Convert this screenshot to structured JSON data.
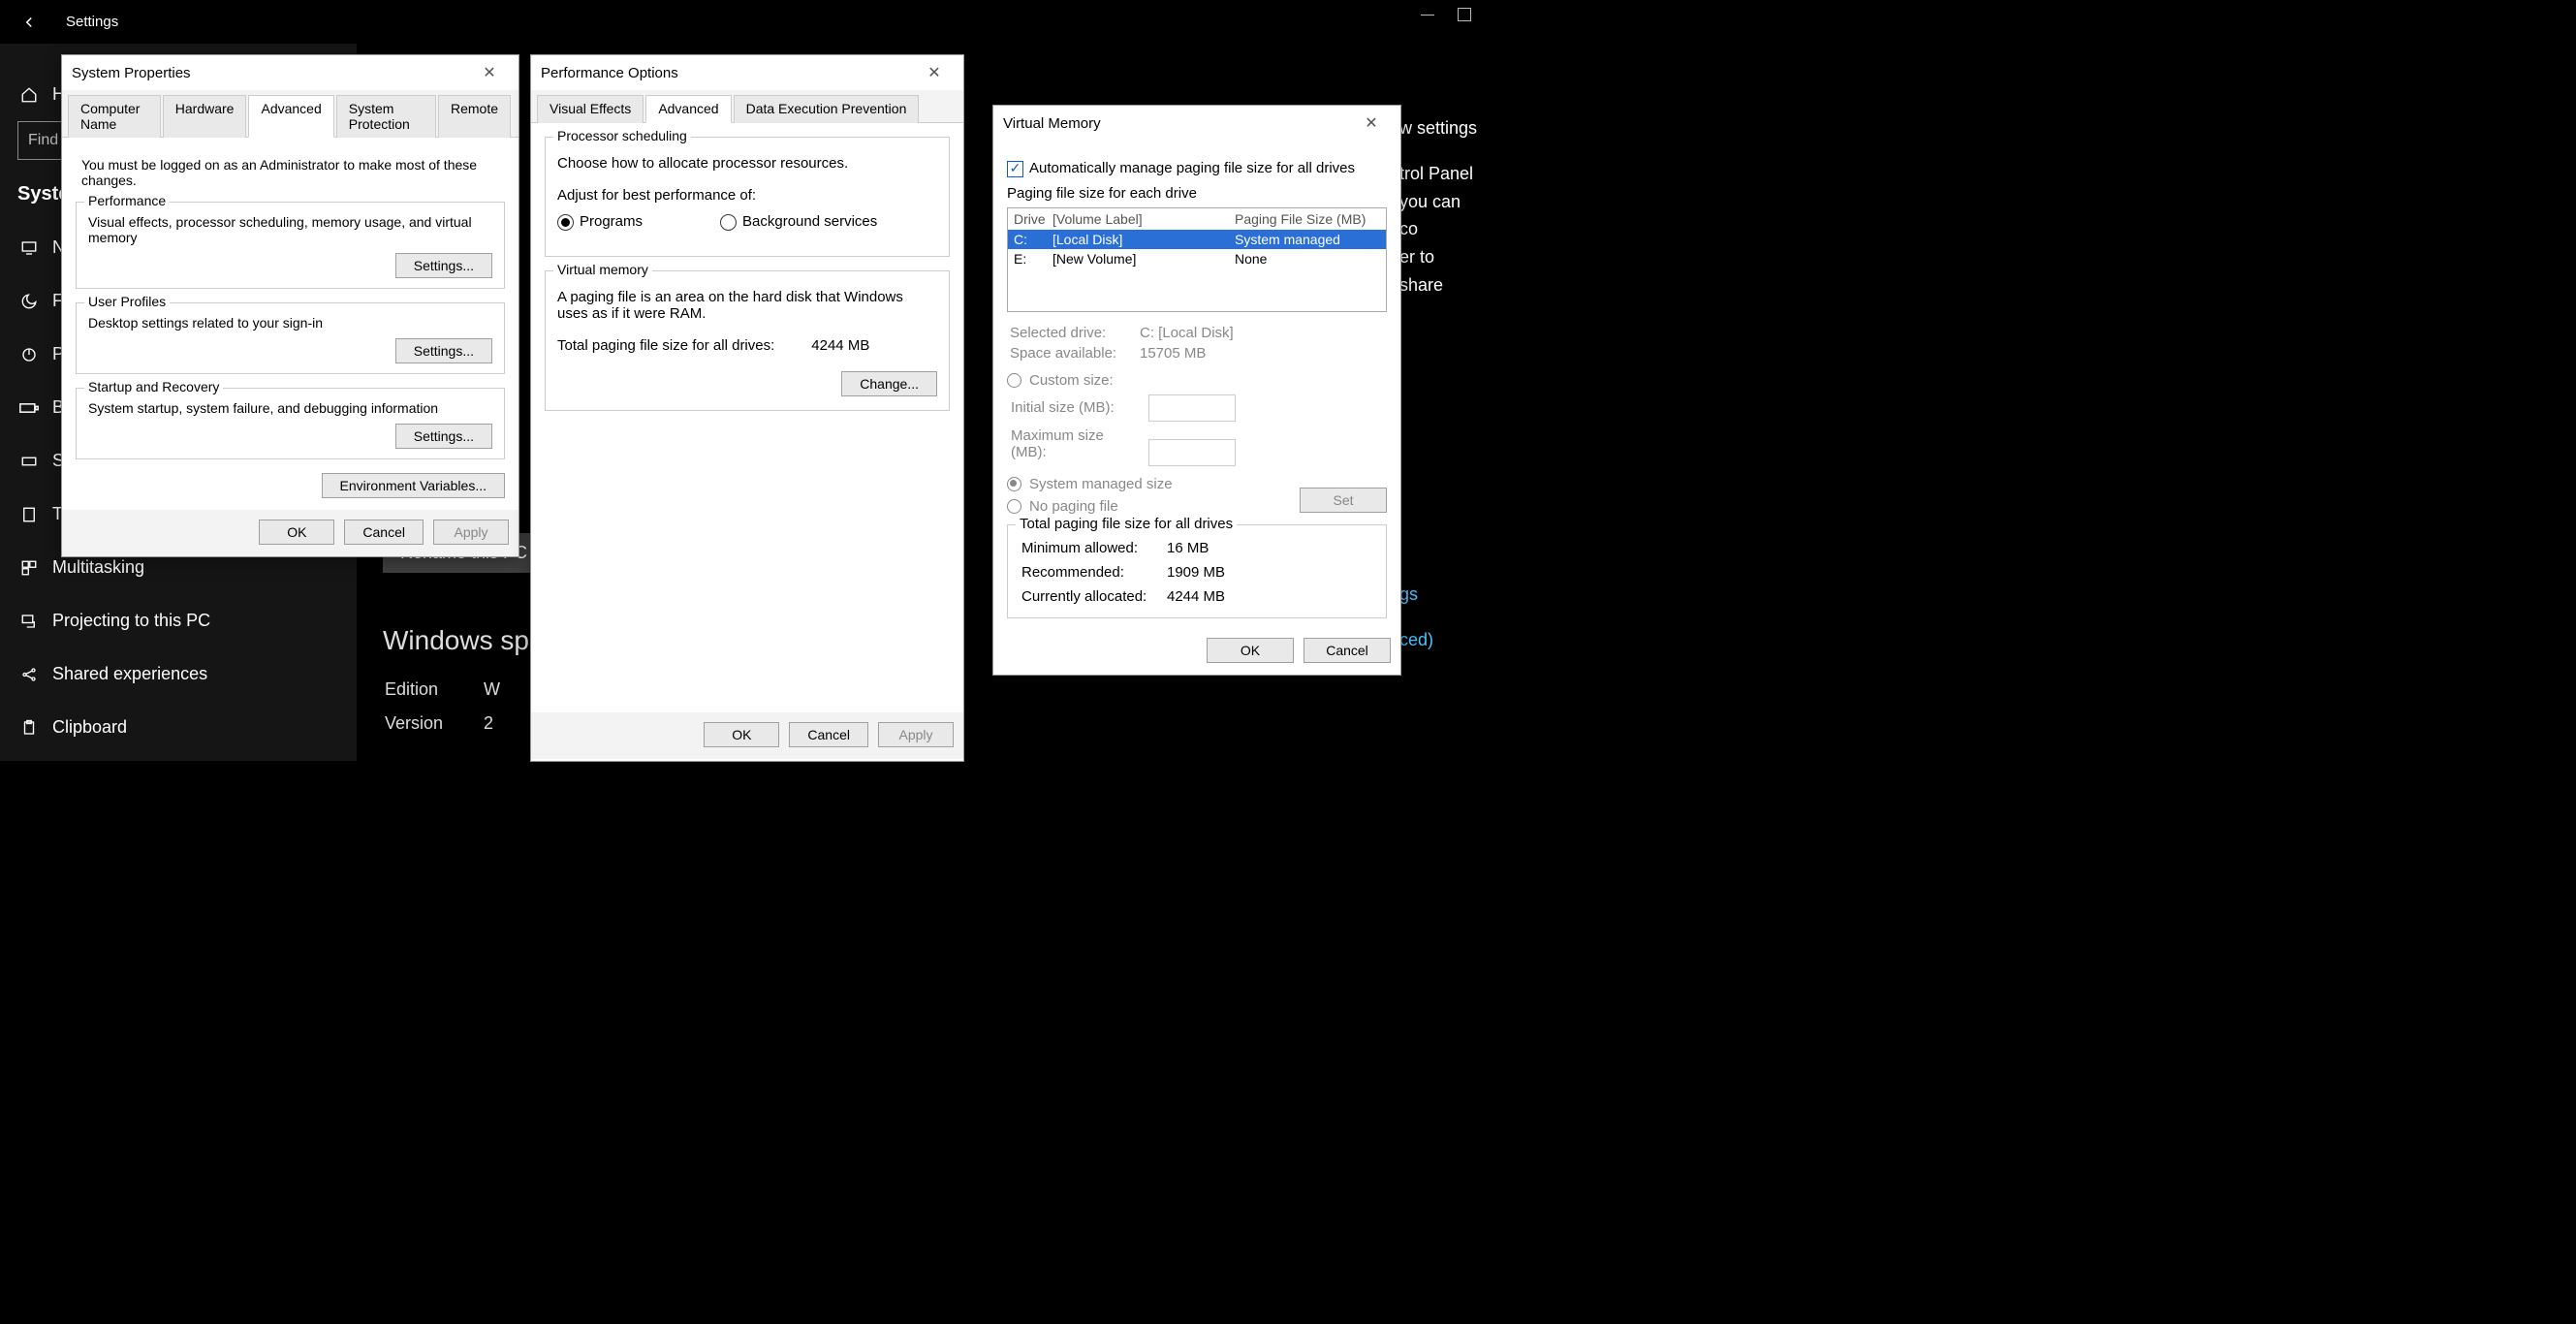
{
  "settings": {
    "title": "Settings",
    "search_placeholder": "Find",
    "section": "System",
    "sidebar": [
      {
        "label": "H",
        "icon": "home"
      },
      {
        "label": "N",
        "icon": "monitor"
      },
      {
        "label": "F",
        "icon": "moon"
      },
      {
        "label": "P",
        "icon": "power"
      },
      {
        "label": "B",
        "icon": "battery"
      },
      {
        "label": "S",
        "icon": "storage"
      },
      {
        "label": "T",
        "icon": "tablet"
      },
      {
        "label": "Multitasking",
        "icon": "multitask"
      },
      {
        "label": "Projecting to this PC",
        "icon": "project"
      },
      {
        "label": "Shared experiences",
        "icon": "share"
      },
      {
        "label": "Clipboard",
        "icon": "clipboard"
      }
    ],
    "bg_main": {
      "rename_btn": "Rename this PC",
      "spec_heading": "Windows speci",
      "rows": [
        {
          "k": "Edition",
          "v": "W"
        },
        {
          "k": "Version",
          "v": "2"
        }
      ]
    },
    "bg_right": {
      "l1": "w settings",
      "l2": "trol Panel",
      "l3": "you can co",
      "l4": "er to share",
      "link1": "gs",
      "link2": "ced)"
    }
  },
  "sysprops": {
    "title": "System Properties",
    "tabs": [
      "Computer Name",
      "Hardware",
      "Advanced",
      "System Protection",
      "Remote"
    ],
    "active_tab": "Advanced",
    "note": "You must be logged on as an Administrator to make most of these changes.",
    "perf": {
      "legend": "Performance",
      "desc": "Visual effects, processor scheduling, memory usage, and virtual memory",
      "btn": "Settings..."
    },
    "profiles": {
      "legend": "User Profiles",
      "desc": "Desktop settings related to your sign-in",
      "btn": "Settings..."
    },
    "startup": {
      "legend": "Startup and Recovery",
      "desc": "System startup, system failure, and debugging information",
      "btn": "Settings..."
    },
    "env_btn": "Environment Variables...",
    "ok": "OK",
    "cancel": "Cancel",
    "apply": "Apply"
  },
  "perfopts": {
    "title": "Performance Options",
    "tabs": [
      "Visual Effects",
      "Advanced",
      "Data Execution Prevention"
    ],
    "active_tab": "Advanced",
    "proc": {
      "legend": "Processor scheduling",
      "desc": "Choose how to allocate processor resources.",
      "adjust": "Adjust for best performance of:",
      "opt1": "Programs",
      "opt2": "Background services"
    },
    "vmem": {
      "legend": "Virtual memory",
      "desc": "A paging file is an area on the hard disk that Windows uses as if it were RAM.",
      "total_label": "Total paging file size for all drives:",
      "total_value": "4244 MB",
      "change_btn": "Change..."
    },
    "ok": "OK",
    "cancel": "Cancel",
    "apply": "Apply"
  },
  "vmem": {
    "title": "Virtual Memory",
    "auto_label": "Automatically manage paging file size for all drives",
    "each_drive": "Paging file size for each drive",
    "headers": {
      "drive": "Drive",
      "vol": "[Volume Label]",
      "size": "Paging File Size (MB)"
    },
    "drives": [
      {
        "letter": "C:",
        "label": "[Local Disk]",
        "size": "System managed",
        "selected": true
      },
      {
        "letter": "E:",
        "label": "[New Volume]",
        "size": "None",
        "selected": false
      }
    ],
    "selected_drive_label": "Selected drive:",
    "selected_drive_value": "C:  [Local Disk]",
    "space_label": "Space available:",
    "space_value": "15705 MB",
    "custom": "Custom size:",
    "initial": "Initial size (MB):",
    "max": "Maximum size (MB):",
    "sys_managed": "System managed size",
    "no_paging": "No paging file",
    "set_btn": "Set",
    "totals_legend": "Total paging file size for all drives",
    "min_label": "Minimum allowed:",
    "min_val": "16 MB",
    "rec_label": "Recommended:",
    "rec_val": "1909 MB",
    "cur_label": "Currently allocated:",
    "cur_val": "4244 MB",
    "ok": "OK",
    "cancel": "Cancel"
  }
}
